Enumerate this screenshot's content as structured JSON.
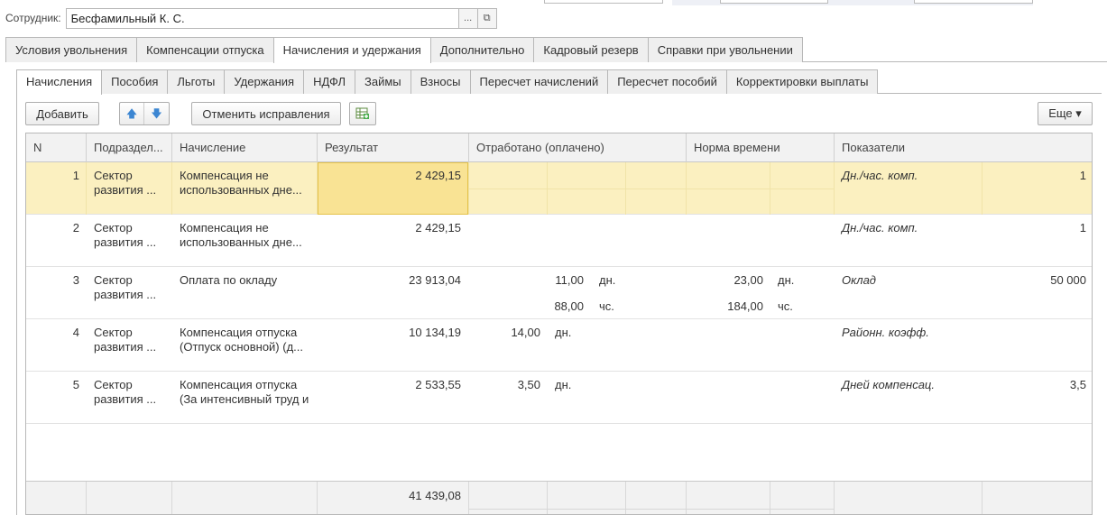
{
  "employee": {
    "label": "Сотрудник:",
    "value": "Бесфамильный К. С.",
    "select_btn": "...",
    "open_btn": "⧉"
  },
  "main_tabs": [
    {
      "label": "Условия увольнения"
    },
    {
      "label": "Компенсации отпуска"
    },
    {
      "label": "Начисления и удержания"
    },
    {
      "label": "Дополнительно"
    },
    {
      "label": "Кадровый резерв"
    },
    {
      "label": "Справки при увольнении"
    }
  ],
  "sub_tabs": [
    {
      "label": "Начисления"
    },
    {
      "label": "Пособия"
    },
    {
      "label": "Льготы"
    },
    {
      "label": "Удержания"
    },
    {
      "label": "НДФЛ"
    },
    {
      "label": "Займы"
    },
    {
      "label": "Взносы"
    },
    {
      "label": "Пересчет начислений"
    },
    {
      "label": "Пересчет пособий"
    },
    {
      "label": "Корректировки выплаты"
    }
  ],
  "toolbar": {
    "add": "Добавить",
    "up": "🡅",
    "down": "🡇",
    "cancel_corrections": "Отменить исправления",
    "more": "Еще ▾"
  },
  "columns": {
    "n": "N",
    "division": "Подраздел...",
    "accrual": "Начисление",
    "result": "Результат",
    "worked": "Отработано (оплачено)",
    "norm": "Норма времени",
    "indicators": "Показатели"
  },
  "rows": [
    {
      "n": "1",
      "div1": "Сектор",
      "div2": "развития ...",
      "acc1": "Компенсация не",
      "acc2": "использованных дне...",
      "result": "2 429,15",
      "w1": "",
      "w1u": "",
      "w2": "",
      "w2u": "",
      "n1": "",
      "n1u": "",
      "n2": "",
      "n2u": "",
      "ind": "Дн./час. комп.",
      "indv": "1"
    },
    {
      "n": "2",
      "div1": "Сектор",
      "div2": "развития ...",
      "acc1": "Компенсация не",
      "acc2": "использованных дне...",
      "result": "2 429,15",
      "w1": "",
      "w1u": "",
      "w2": "",
      "w2u": "",
      "n1": "",
      "n1u": "",
      "n2": "",
      "n2u": "",
      "ind": "Дн./час. комп.",
      "indv": "1"
    },
    {
      "n": "3",
      "div1": "Сектор",
      "div2": "развития ...",
      "acc1": "Оплата по окладу",
      "acc2": "",
      "result": "23 913,04",
      "w1": "11,00",
      "w1u": "дн.",
      "w2": "88,00",
      "w2u": "чс.",
      "n1": "23,00",
      "n1u": "дн.",
      "n2": "184,00",
      "n2u": "чс.",
      "ind": "Оклад",
      "indv": "50 000"
    },
    {
      "n": "4",
      "div1": "Сектор",
      "div2": "развития ...",
      "acc1": "Компенсация отпуска",
      "acc2": "(Отпуск основной) (д...",
      "result": "10 134,19",
      "w1": "14,00",
      "w1u": "дн.",
      "w2": "",
      "w2u": "",
      "n1": "",
      "n1u": "",
      "n2": "",
      "n2u": "",
      "ind": "Районн. коэфф.",
      "indv": ""
    },
    {
      "n": "5",
      "div1": "Сектор",
      "div2": "развития ...",
      "acc1": "Компенсация отпуска",
      "acc2": "(За интенсивный труд и",
      "result": "2 533,55",
      "w1": "3,50",
      "w1u": "дн.",
      "w2": "",
      "w2u": "",
      "n1": "",
      "n1u": "",
      "n2": "",
      "n2u": "",
      "ind": "Дней компенсац.",
      "indv": "3,5"
    }
  ],
  "footer": {
    "total": "41 439,08"
  }
}
